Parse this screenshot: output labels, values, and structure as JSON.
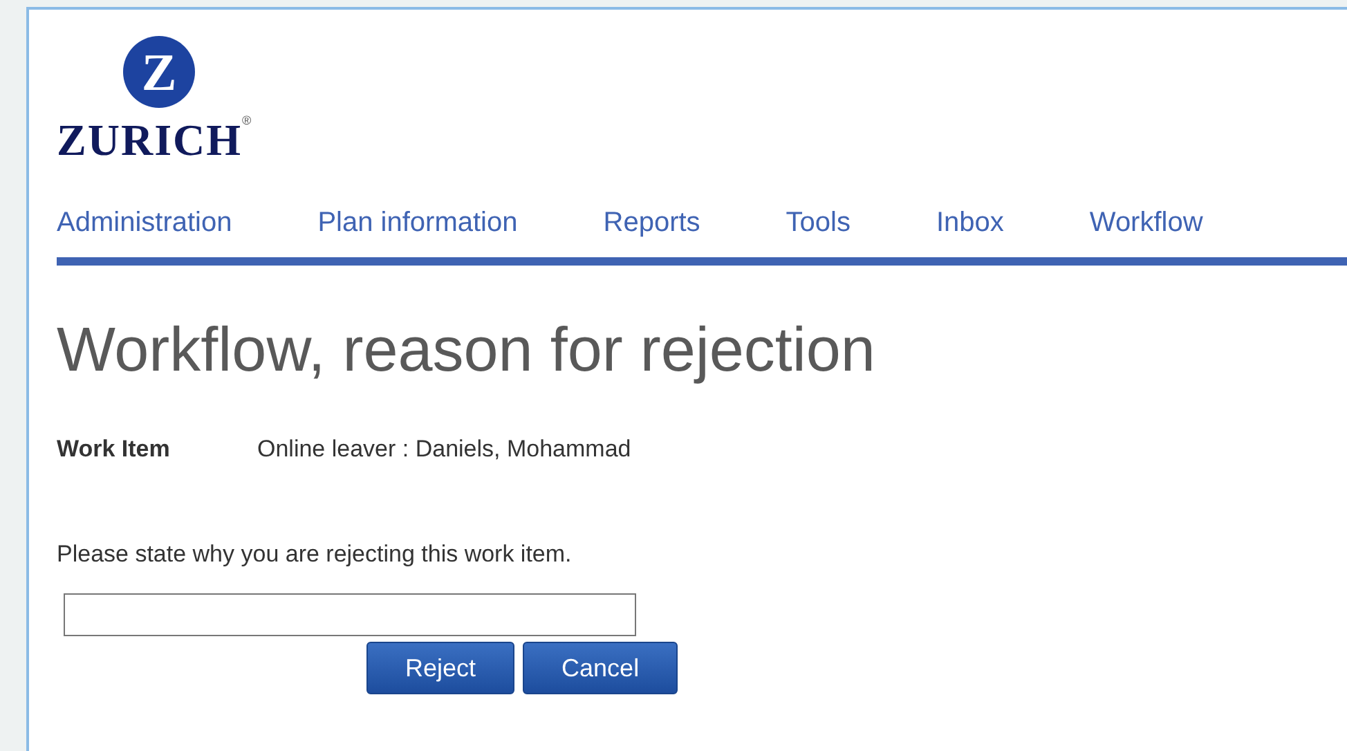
{
  "logo": {
    "mark": "Z",
    "wordmark": "ZURICH",
    "registered": "®"
  },
  "nav": [
    {
      "label": "Administration"
    },
    {
      "label": "Plan information"
    },
    {
      "label": "Reports"
    },
    {
      "label": "Tools"
    },
    {
      "label": "Inbox"
    },
    {
      "label": "Workflow"
    }
  ],
  "title": "Workflow, reason for rejection",
  "work_item": {
    "label": "Work Item",
    "value": "Online leaver : Daniels, Mohammad"
  },
  "prompt": "Please state why you are rejecting this work item.",
  "buttons": [
    {
      "label": "Reject"
    },
    {
      "label": "Cancel"
    }
  ]
}
